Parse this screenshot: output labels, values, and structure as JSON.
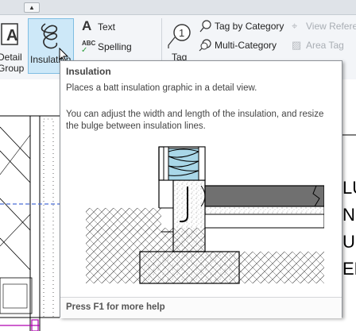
{
  "qat": {
    "dropdown_glyph": "▲"
  },
  "ribbon": {
    "detail_group": {
      "label_line1": "Detail",
      "label_line2": "Group",
      "icon": "detail-group-icon"
    },
    "insulation": {
      "label": "Insulation",
      "icon": "insulation-icon"
    },
    "text": {
      "label": "Text",
      "icon_glyph": "A"
    },
    "spelling": {
      "label": "Spelling",
      "icon_glyph": "ABC"
    },
    "tag": {
      "label": "Tag",
      "icon_glyph": "1"
    },
    "tag_by_category": {
      "label": "Tag by Category"
    },
    "multi_category": {
      "label": "Multi-Category"
    },
    "view_reference": {
      "label": "View Refere"
    },
    "area_tag": {
      "label": "Area Tag"
    }
  },
  "tooltip": {
    "title": "Insulation",
    "summary": "Places a batt insulation graphic in a detail view.",
    "description": "You can adjust the width and length of the insulation, and resize the bulge between insulation lines.",
    "footer": "Press F1 for more help"
  },
  "drawing": {
    "partial_text": [
      "LU",
      "N",
      "U",
      "ER"
    ]
  },
  "colors": {
    "highlight": "#cde8f8",
    "highlight_border": "#7fbde2",
    "insulation": "#a9d7e8"
  }
}
